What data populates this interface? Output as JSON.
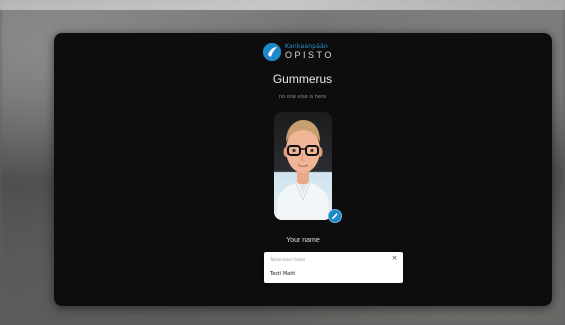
{
  "logo": {
    "line1": "Kankaanpään",
    "line2": "OPISTO",
    "icon": "opisto-logo-icon",
    "brand_color": "#1f88c6"
  },
  "room": {
    "title": "Gummerus",
    "status": "no one else is here"
  },
  "avatar": {
    "edit_icon": "pencil-icon"
  },
  "name": {
    "label": "Your name",
    "field_hint": "Tallennetut tiedot",
    "value": "Testi Matti",
    "close_glyph": "×"
  }
}
